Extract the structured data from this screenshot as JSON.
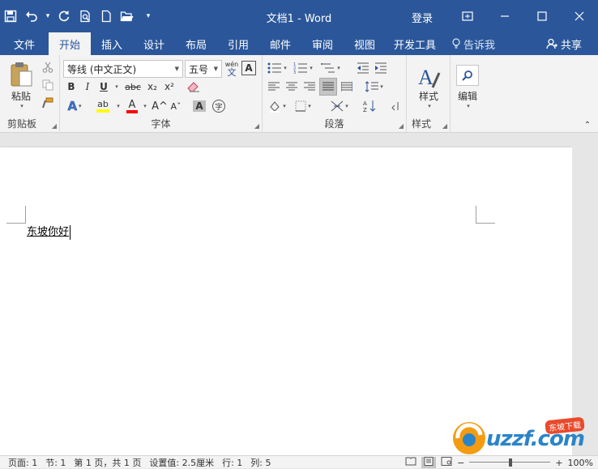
{
  "title": "文档1  -  Word",
  "login": "登录",
  "tabs": [
    "文件",
    "开始",
    "插入",
    "设计",
    "布局",
    "引用",
    "邮件",
    "审阅",
    "视图",
    "开发工具"
  ],
  "search_tab": "告诉我",
  "share": "共享",
  "ribbon": {
    "paste": "粘贴",
    "clipboard": "剪贴板",
    "font_name": "等线 (中文正文)",
    "font_size": "五号",
    "wen_top": "wén",
    "wen_bottom": "文",
    "font_group": "字体",
    "paragraph_group": "段落",
    "styles": "样式",
    "styles_group": "样式",
    "edit": "编辑",
    "bold": "B",
    "italic": "I",
    "underline": "U",
    "strike": "abc",
    "sub": "x₂",
    "sup": "x²",
    "A": "A",
    "grow": "A^",
    "shrink": "Aˇ",
    "char_border": "A",
    "phonetic": "字"
  },
  "document": {
    "text": "东坡你好"
  },
  "status": {
    "page": "页面: 1",
    "section": "节: 1",
    "pages": "第 1 页，共 1 页",
    "setting": "设置值: 2.5厘米",
    "line": "行: 1",
    "col": "列: 5",
    "zoom": "100%"
  },
  "watermark": {
    "text": "uzzf.com",
    "tag": "东坡下载"
  },
  "colors": {
    "brand": "#2b579a",
    "highlight": "#ffff00",
    "font_color": "#ff0000"
  }
}
